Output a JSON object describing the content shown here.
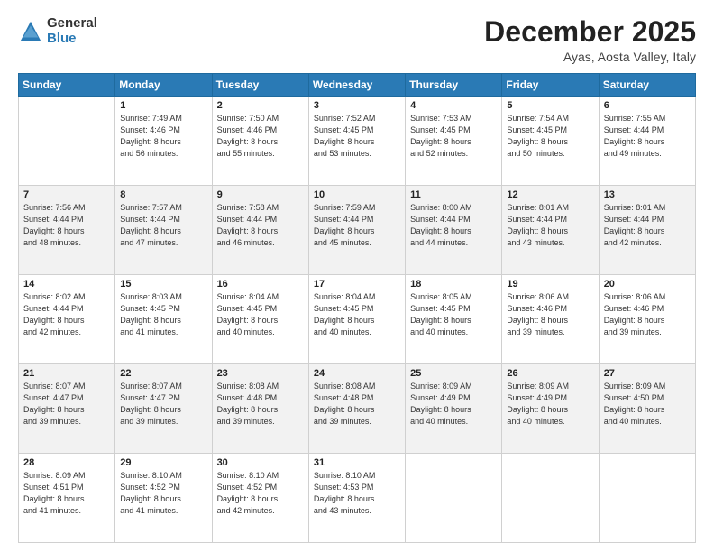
{
  "header": {
    "logo_general": "General",
    "logo_blue": "Blue",
    "month_title": "December 2025",
    "location": "Ayas, Aosta Valley, Italy"
  },
  "weekdays": [
    "Sunday",
    "Monday",
    "Tuesday",
    "Wednesday",
    "Thursday",
    "Friday",
    "Saturday"
  ],
  "weeks": [
    [
      {
        "day": "",
        "lines": []
      },
      {
        "day": "1",
        "lines": [
          "Sunrise: 7:49 AM",
          "Sunset: 4:46 PM",
          "Daylight: 8 hours",
          "and 56 minutes."
        ]
      },
      {
        "day": "2",
        "lines": [
          "Sunrise: 7:50 AM",
          "Sunset: 4:46 PM",
          "Daylight: 8 hours",
          "and 55 minutes."
        ]
      },
      {
        "day": "3",
        "lines": [
          "Sunrise: 7:52 AM",
          "Sunset: 4:45 PM",
          "Daylight: 8 hours",
          "and 53 minutes."
        ]
      },
      {
        "day": "4",
        "lines": [
          "Sunrise: 7:53 AM",
          "Sunset: 4:45 PM",
          "Daylight: 8 hours",
          "and 52 minutes."
        ]
      },
      {
        "day": "5",
        "lines": [
          "Sunrise: 7:54 AM",
          "Sunset: 4:45 PM",
          "Daylight: 8 hours",
          "and 50 minutes."
        ]
      },
      {
        "day": "6",
        "lines": [
          "Sunrise: 7:55 AM",
          "Sunset: 4:44 PM",
          "Daylight: 8 hours",
          "and 49 minutes."
        ]
      }
    ],
    [
      {
        "day": "7",
        "lines": [
          "Sunrise: 7:56 AM",
          "Sunset: 4:44 PM",
          "Daylight: 8 hours",
          "and 48 minutes."
        ]
      },
      {
        "day": "8",
        "lines": [
          "Sunrise: 7:57 AM",
          "Sunset: 4:44 PM",
          "Daylight: 8 hours",
          "and 47 minutes."
        ]
      },
      {
        "day": "9",
        "lines": [
          "Sunrise: 7:58 AM",
          "Sunset: 4:44 PM",
          "Daylight: 8 hours",
          "and 46 minutes."
        ]
      },
      {
        "day": "10",
        "lines": [
          "Sunrise: 7:59 AM",
          "Sunset: 4:44 PM",
          "Daylight: 8 hours",
          "and 45 minutes."
        ]
      },
      {
        "day": "11",
        "lines": [
          "Sunrise: 8:00 AM",
          "Sunset: 4:44 PM",
          "Daylight: 8 hours",
          "and 44 minutes."
        ]
      },
      {
        "day": "12",
        "lines": [
          "Sunrise: 8:01 AM",
          "Sunset: 4:44 PM",
          "Daylight: 8 hours",
          "and 43 minutes."
        ]
      },
      {
        "day": "13",
        "lines": [
          "Sunrise: 8:01 AM",
          "Sunset: 4:44 PM",
          "Daylight: 8 hours",
          "and 42 minutes."
        ]
      }
    ],
    [
      {
        "day": "14",
        "lines": [
          "Sunrise: 8:02 AM",
          "Sunset: 4:44 PM",
          "Daylight: 8 hours",
          "and 42 minutes."
        ]
      },
      {
        "day": "15",
        "lines": [
          "Sunrise: 8:03 AM",
          "Sunset: 4:45 PM",
          "Daylight: 8 hours",
          "and 41 minutes."
        ]
      },
      {
        "day": "16",
        "lines": [
          "Sunrise: 8:04 AM",
          "Sunset: 4:45 PM",
          "Daylight: 8 hours",
          "and 40 minutes."
        ]
      },
      {
        "day": "17",
        "lines": [
          "Sunrise: 8:04 AM",
          "Sunset: 4:45 PM",
          "Daylight: 8 hours",
          "and 40 minutes."
        ]
      },
      {
        "day": "18",
        "lines": [
          "Sunrise: 8:05 AM",
          "Sunset: 4:45 PM",
          "Daylight: 8 hours",
          "and 40 minutes."
        ]
      },
      {
        "day": "19",
        "lines": [
          "Sunrise: 8:06 AM",
          "Sunset: 4:46 PM",
          "Daylight: 8 hours",
          "and 39 minutes."
        ]
      },
      {
        "day": "20",
        "lines": [
          "Sunrise: 8:06 AM",
          "Sunset: 4:46 PM",
          "Daylight: 8 hours",
          "and 39 minutes."
        ]
      }
    ],
    [
      {
        "day": "21",
        "lines": [
          "Sunrise: 8:07 AM",
          "Sunset: 4:47 PM",
          "Daylight: 8 hours",
          "and 39 minutes."
        ]
      },
      {
        "day": "22",
        "lines": [
          "Sunrise: 8:07 AM",
          "Sunset: 4:47 PM",
          "Daylight: 8 hours",
          "and 39 minutes."
        ]
      },
      {
        "day": "23",
        "lines": [
          "Sunrise: 8:08 AM",
          "Sunset: 4:48 PM",
          "Daylight: 8 hours",
          "and 39 minutes."
        ]
      },
      {
        "day": "24",
        "lines": [
          "Sunrise: 8:08 AM",
          "Sunset: 4:48 PM",
          "Daylight: 8 hours",
          "and 39 minutes."
        ]
      },
      {
        "day": "25",
        "lines": [
          "Sunrise: 8:09 AM",
          "Sunset: 4:49 PM",
          "Daylight: 8 hours",
          "and 40 minutes."
        ]
      },
      {
        "day": "26",
        "lines": [
          "Sunrise: 8:09 AM",
          "Sunset: 4:49 PM",
          "Daylight: 8 hours",
          "and 40 minutes."
        ]
      },
      {
        "day": "27",
        "lines": [
          "Sunrise: 8:09 AM",
          "Sunset: 4:50 PM",
          "Daylight: 8 hours",
          "and 40 minutes."
        ]
      }
    ],
    [
      {
        "day": "28",
        "lines": [
          "Sunrise: 8:09 AM",
          "Sunset: 4:51 PM",
          "Daylight: 8 hours",
          "and 41 minutes."
        ]
      },
      {
        "day": "29",
        "lines": [
          "Sunrise: 8:10 AM",
          "Sunset: 4:52 PM",
          "Daylight: 8 hours",
          "and 41 minutes."
        ]
      },
      {
        "day": "30",
        "lines": [
          "Sunrise: 8:10 AM",
          "Sunset: 4:52 PM",
          "Daylight: 8 hours",
          "and 42 minutes."
        ]
      },
      {
        "day": "31",
        "lines": [
          "Sunrise: 8:10 AM",
          "Sunset: 4:53 PM",
          "Daylight: 8 hours",
          "and 43 minutes."
        ]
      },
      {
        "day": "",
        "lines": []
      },
      {
        "day": "",
        "lines": []
      },
      {
        "day": "",
        "lines": []
      }
    ]
  ]
}
